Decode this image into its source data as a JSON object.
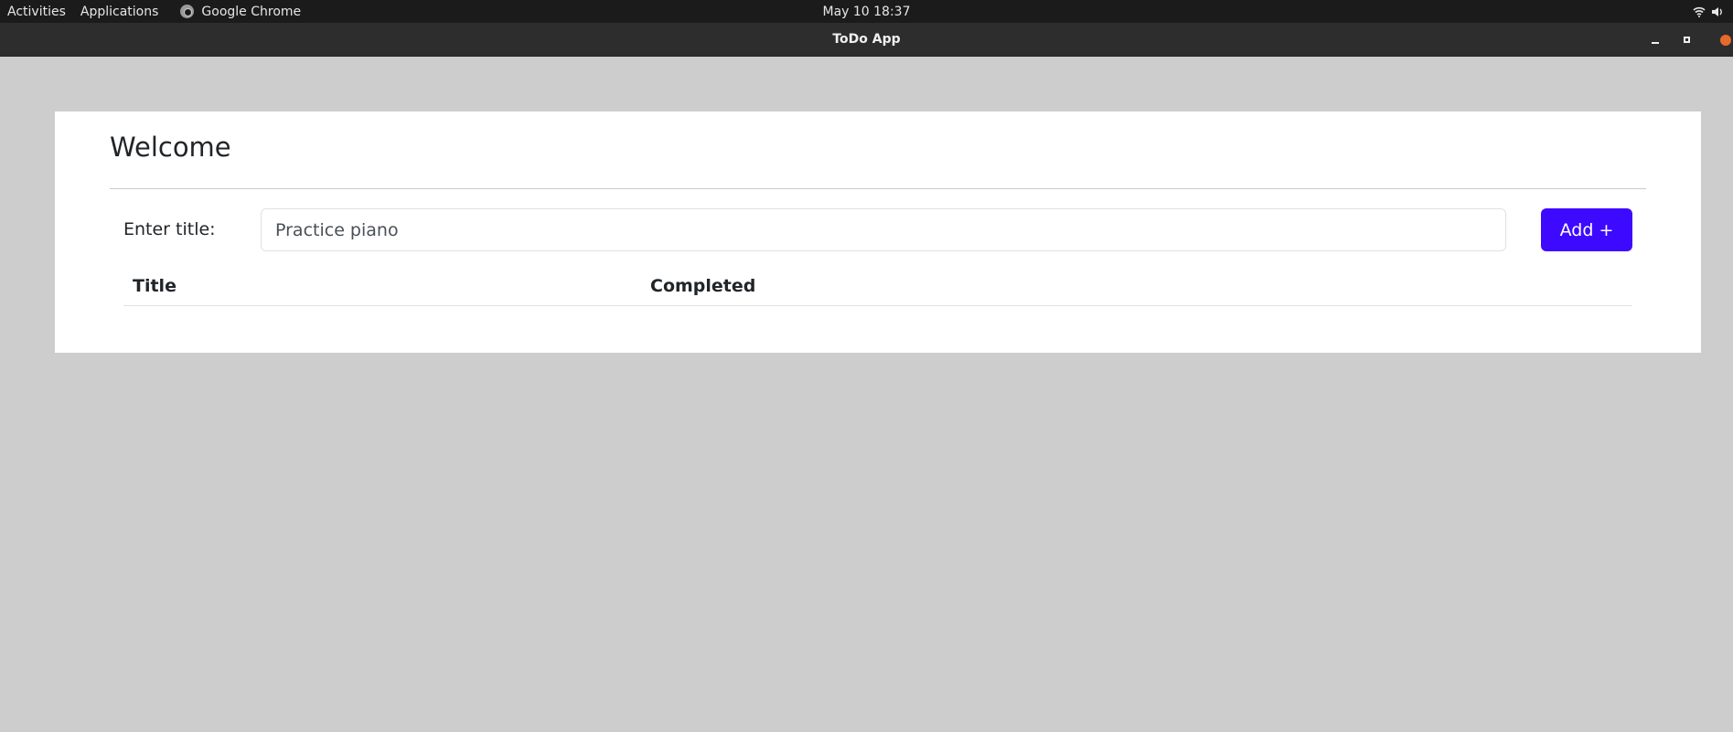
{
  "system_bar": {
    "activities": "Activities",
    "applications": "Applications",
    "app_name": "Google Chrome",
    "clock": "May 10  18:37",
    "tray_icons": [
      "wifi-icon",
      "volume-icon"
    ]
  },
  "window": {
    "title": "ToDo App",
    "controls": [
      "minimize-icon",
      "maximize-icon",
      "close-icon"
    ]
  },
  "page": {
    "heading": "Welcome",
    "form": {
      "label": "Enter title:",
      "input_value": "Practice piano",
      "add_button": "Add +"
    },
    "table": {
      "columns": [
        "Title",
        "Completed"
      ],
      "rows": []
    }
  },
  "colors": {
    "accent": "#3d0aff",
    "background": "#cdcdcd",
    "card": "#ffffff",
    "topbar": "#1b1b1b",
    "titlebar": "#2d2d2d"
  }
}
